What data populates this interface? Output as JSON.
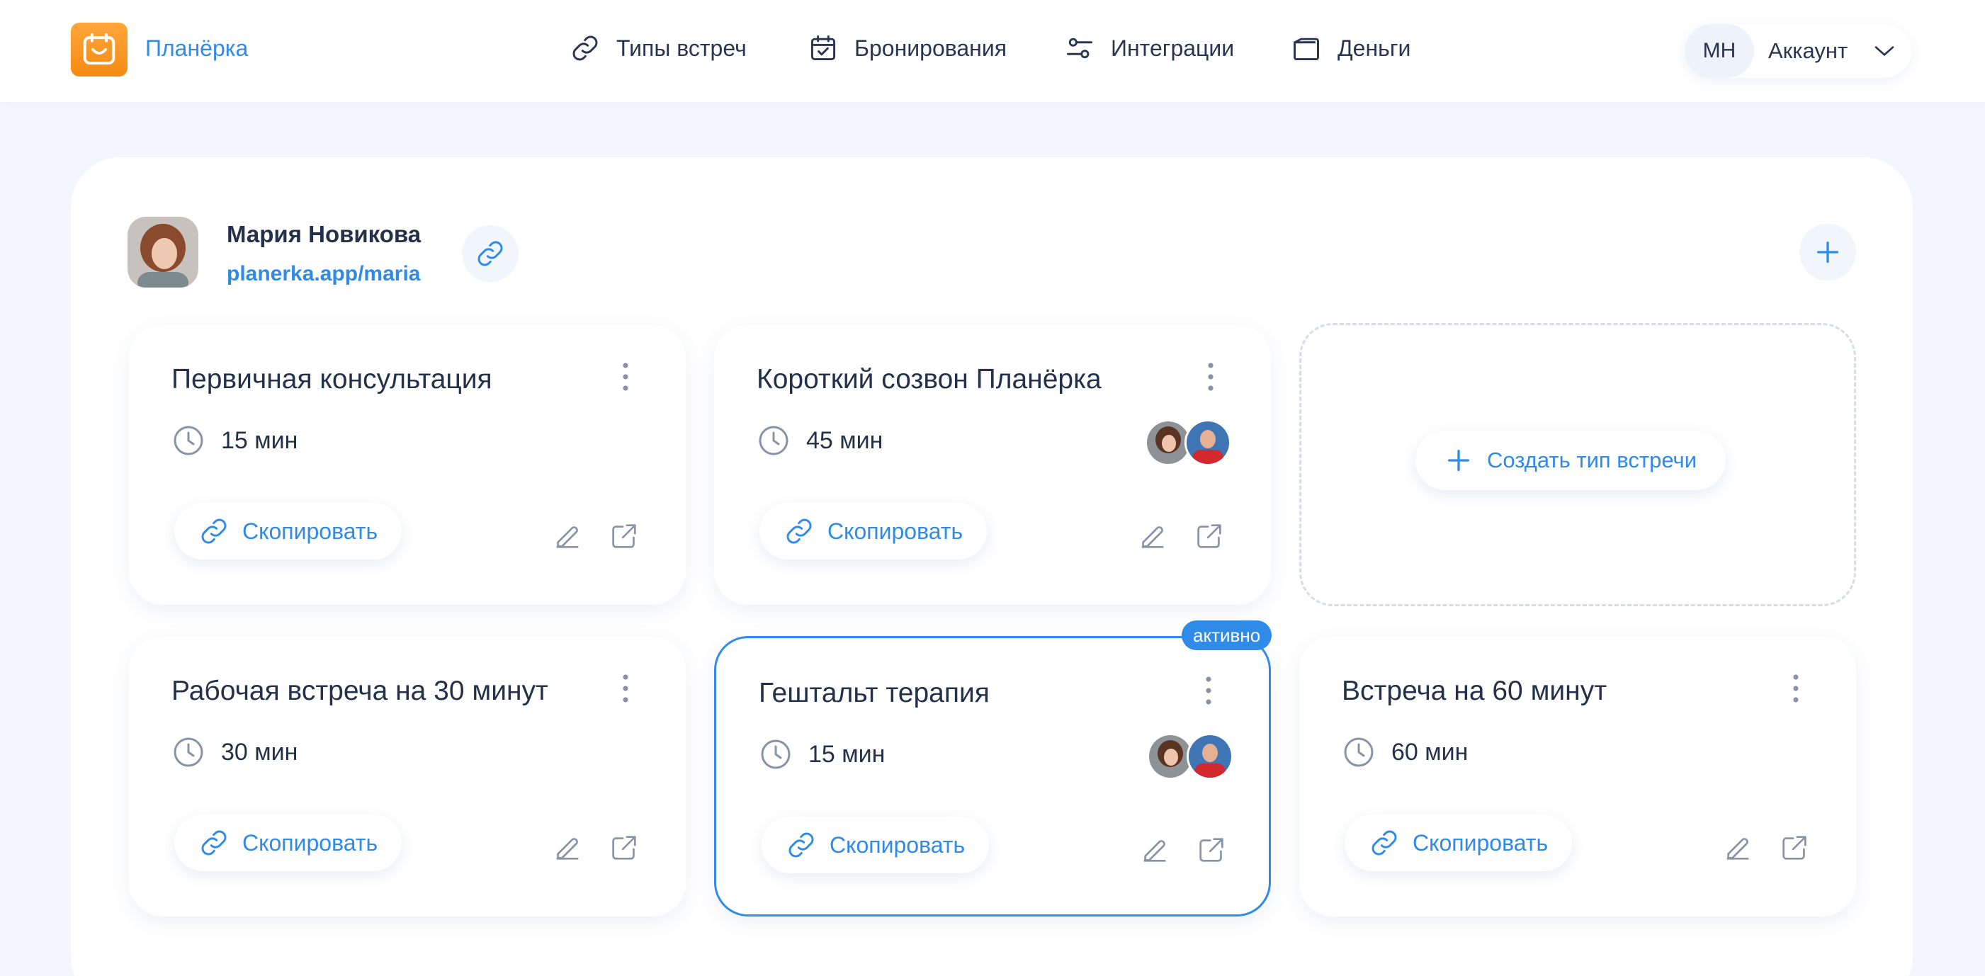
{
  "header": {
    "brand": "Планёрка",
    "nav": [
      {
        "label": "Типы встреч",
        "icon": "link-icon"
      },
      {
        "label": "Бронирования",
        "icon": "calendar-check-icon"
      },
      {
        "label": "Интеграции",
        "icon": "sliders-icon"
      },
      {
        "label": "Деньги",
        "icon": "wallet-icon"
      }
    ],
    "account": {
      "initials": "МН",
      "label": "Аккаунт"
    }
  },
  "profile": {
    "name": "Мария Новикова",
    "link": "planerka.app/maria"
  },
  "cards": [
    {
      "title": "Первичная консультация",
      "duration": "15 мин",
      "copy_label": "Скопировать",
      "has_participants": false,
      "active": false
    },
    {
      "title": "Короткий созвон Планёрка",
      "duration": "45 мин",
      "copy_label": "Скопировать",
      "has_participants": true,
      "active": false
    },
    {
      "title": "Рабочая встреча на 30 минут",
      "duration": "30 мин",
      "copy_label": "Скопировать",
      "has_participants": false,
      "active": false
    },
    {
      "title": "Гештальт терапия",
      "duration": "15 мин",
      "copy_label": "Скопировать",
      "has_participants": true,
      "active": true
    },
    {
      "title": "Встреча на 60 минут",
      "duration": "60 мин",
      "copy_label": "Скопировать",
      "has_participants": false,
      "active": false
    }
  ],
  "active_badge": "активно",
  "create_label": "Создать тип встречи",
  "colors": {
    "accent": "#2f8ae8",
    "logo": "#f7941d",
    "text": "#23324a",
    "background": "#f3f6fd"
  }
}
